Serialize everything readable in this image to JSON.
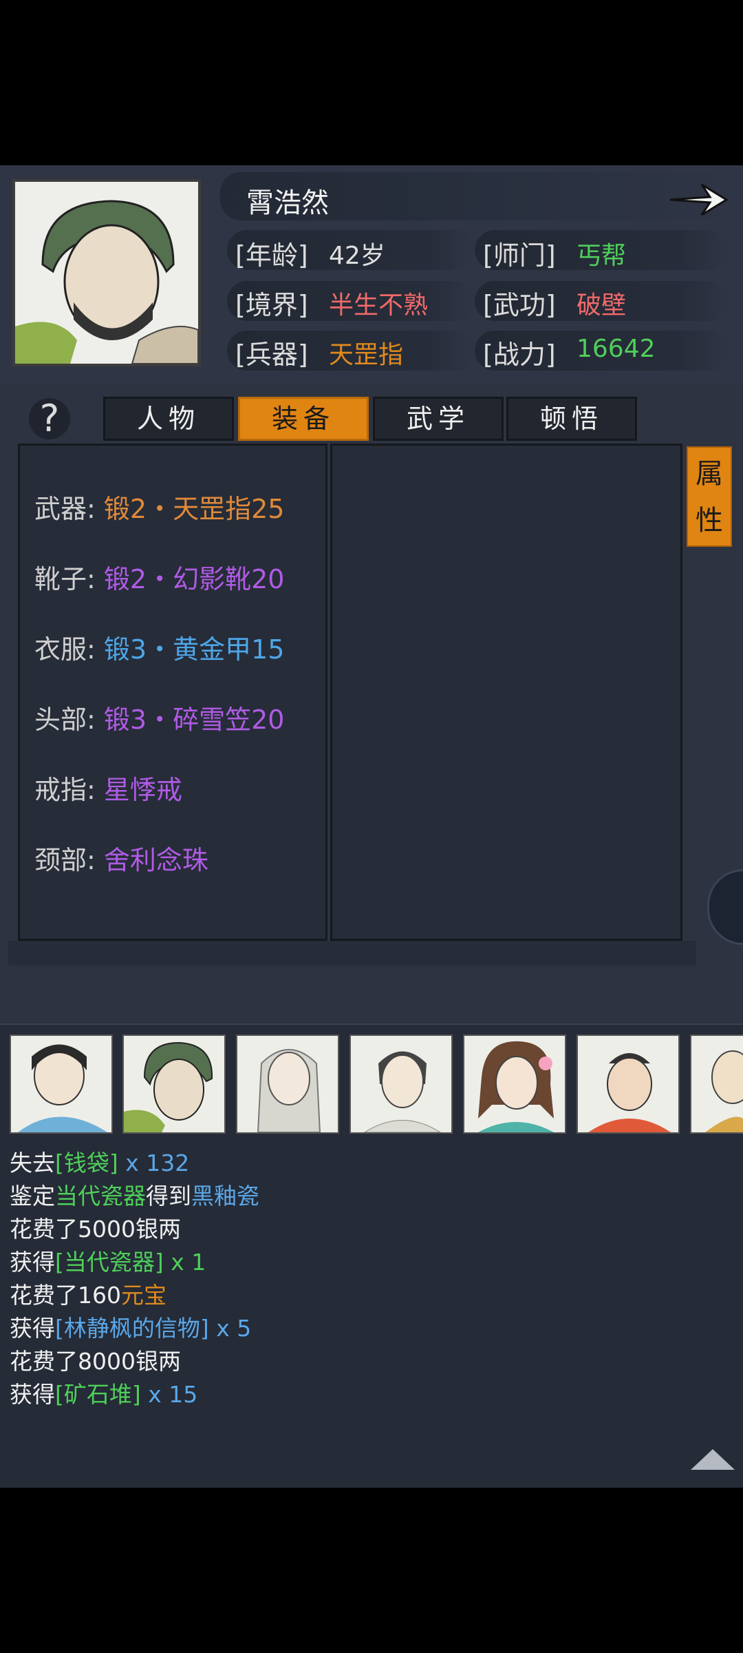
{
  "character": {
    "name": "霄浩然",
    "stats": {
      "age_label": "[年龄]",
      "age_value": "42岁",
      "sect_label": "[师门]",
      "sect_value": "丐帮",
      "realm_label": "[境界]",
      "realm_value": "半生不熟",
      "martial_label": "[武功]",
      "martial_value": "破壁",
      "weapon_label": "[兵器]",
      "weapon_value": "天罡指",
      "power_label": "[战力]",
      "power_value": "16642"
    }
  },
  "help_icon": "?",
  "tabs": [
    "人物",
    "装备",
    "武学",
    "顿悟"
  ],
  "active_tab": "装备",
  "attr_tab": [
    "属",
    "性"
  ],
  "equipment": [
    {
      "slot": "武器:",
      "item": "锻2・天罡指25",
      "color": "#e08a3a"
    },
    {
      "slot": "靴子:",
      "item": "锻2・幻影靴20",
      "color": "#b05be6"
    },
    {
      "slot": "衣服:",
      "item": "锻3・黄金甲15",
      "color": "#4ea6e8"
    },
    {
      "slot": "头部:",
      "item": "锻3・碎雪笠20",
      "color": "#b05be6"
    },
    {
      "slot": "戒指:",
      "item": "星悸戒",
      "color": "#b05be6"
    },
    {
      "slot": "颈部:",
      "item": "舍利念珠",
      "color": "#b05be6"
    }
  ],
  "log": {
    "l1_a": "失去",
    "l1_b": "[钱袋]",
    "l1_c": " x 132",
    "l2_a": "鉴定",
    "l2_b": "当代瓷器",
    "l2_c": "得到",
    "l2_d": "黑釉瓷",
    "l3": "花费了5000银两",
    "l4_a": "获得",
    "l4_b": "[当代瓷器]",
    "l4_c": " x 1",
    "l5_a": "花费了160",
    "l5_b": "元宝",
    "l6_a": "获得",
    "l6_b": "[林静枫的信物]",
    "l6_c": " x 5",
    "l7": "花费了8000银两",
    "l8_a": "获得",
    "l8_b": "[矿石堆]",
    "l8_c": " x 15"
  },
  "colors": {
    "accent": "#e08412",
    "green": "#4fcf5a",
    "red": "#f06a6a",
    "orange": "#e08a1c",
    "blue": "#5aa7e8",
    "purple": "#b05be6"
  }
}
